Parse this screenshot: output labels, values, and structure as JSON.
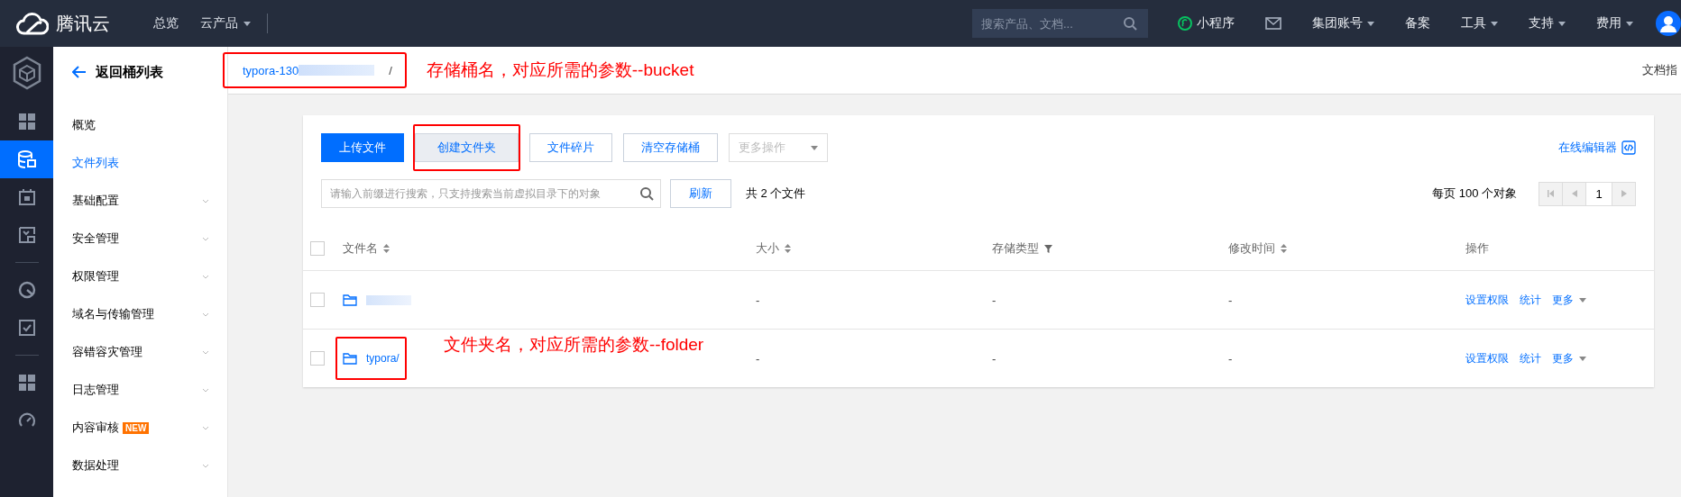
{
  "topbar": {
    "brand": "腾讯云",
    "nav": [
      {
        "label": "总览",
        "dropdown": false
      },
      {
        "label": "云产品",
        "dropdown": true
      }
    ],
    "search": {
      "placeholder": "搜索产品、文档..."
    },
    "links": [
      {
        "kind": "miniapp",
        "label": "小程序",
        "dropdown": false
      },
      {
        "kind": "mail"
      },
      {
        "kind": "text",
        "label": "集团账号",
        "dropdown": true
      },
      {
        "kind": "text",
        "label": "备案",
        "dropdown": false
      },
      {
        "kind": "text",
        "label": "工具",
        "dropdown": true
      },
      {
        "kind": "text",
        "label": "支持",
        "dropdown": true
      },
      {
        "kind": "text",
        "label": "费用",
        "dropdown": true
      },
      {
        "kind": "avatar"
      }
    ]
  },
  "rail": [
    {
      "selected": false
    },
    {
      "selected": true
    },
    {
      "selected": false
    },
    {
      "selected": false
    },
    {
      "selected": false
    },
    {
      "selected": false
    },
    {
      "selected": false
    },
    {
      "selected": false
    }
  ],
  "sidebar": {
    "back": "返回桶列表",
    "items": [
      {
        "label": "概览",
        "selected": false,
        "expandable": false
      },
      {
        "label": "文件列表",
        "selected": true,
        "expandable": false
      },
      {
        "label": "基础配置",
        "selected": false,
        "expandable": true
      },
      {
        "label": "安全管理",
        "selected": false,
        "expandable": true
      },
      {
        "label": "权限管理",
        "selected": false,
        "expandable": true
      },
      {
        "label": "域名与传输管理",
        "selected": false,
        "expandable": true
      },
      {
        "label": "容错容灾管理",
        "selected": false,
        "expandable": true
      },
      {
        "label": "日志管理",
        "selected": false,
        "expandable": true
      },
      {
        "label": "内容审核",
        "badge": "NEW",
        "selected": false,
        "expandable": true
      },
      {
        "label": "数据处理",
        "selected": false,
        "expandable": true
      }
    ]
  },
  "breadcrumb": {
    "bucket": "typora-130",
    "redacted": true,
    "separator": "/",
    "highlighted": true,
    "note": "存储桶名，对应所需的参数--bucket",
    "doc_link": "文档指"
  },
  "toolbar": {
    "buttons": [
      {
        "label": "上传文件",
        "kind": "primary",
        "highlighted": false
      },
      {
        "label": "创建文件夹",
        "kind": "pressed",
        "highlighted": true
      },
      {
        "label": "文件碎片",
        "kind": "default",
        "highlighted": false
      },
      {
        "label": "清空存储桶",
        "kind": "default",
        "highlighted": false
      }
    ],
    "more_select": {
      "placeholder": "更多操作"
    },
    "editor_link": "在线编辑器",
    "search": {
      "placeholder": "请输入前缀进行搜索，只支持搜索当前虚拟目录下的对象"
    },
    "refresh": "刷新",
    "count": "共 2 个文件",
    "per_page": "每页 100 个对象",
    "page": "1"
  },
  "table": {
    "select_all_checked": false,
    "columns": [
      {
        "label": "文件名",
        "kind": "sort"
      },
      {
        "label": "大小",
        "kind": "sort"
      },
      {
        "label": "存储类型",
        "kind": "filter"
      },
      {
        "label": "修改时间",
        "kind": "sort"
      },
      {
        "label": "操作",
        "kind": "none"
      }
    ],
    "rows": [
      {
        "kind": "redacted",
        "checked": false,
        "highlighted": false,
        "size": "-",
        "storage": "-",
        "modified": "-",
        "actions": [
          "设置权限",
          "统计",
          "更多"
        ]
      },
      {
        "kind": "named",
        "name": "typora/",
        "checked": false,
        "highlighted": true,
        "note": "文件夹名，对应所需的参数--folder",
        "size": "-",
        "storage": "-",
        "modified": "-",
        "actions": [
          "设置权限",
          "统计",
          "更多"
        ]
      }
    ]
  }
}
